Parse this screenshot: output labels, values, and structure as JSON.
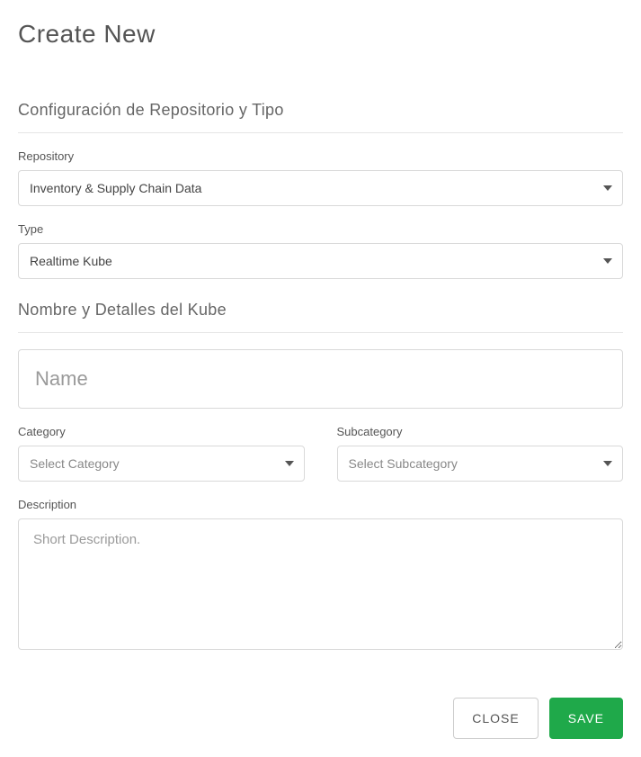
{
  "title": "Create New",
  "section1": {
    "heading": "Configuración de Repositorio y Tipo",
    "repository_label": "Repository",
    "repository_value": "Inventory & Supply Chain Data",
    "type_label": "Type",
    "type_value": "Realtime Kube"
  },
  "section2": {
    "heading": "Nombre y Detalles del Kube",
    "name_placeholder": "Name",
    "category_label": "Category",
    "category_placeholder": "Select Category",
    "subcategory_label": "Subcategory",
    "subcategory_placeholder": "Select Subcategory",
    "description_label": "Description",
    "description_placeholder": "Short Description."
  },
  "footer": {
    "close_label": "CLOSE",
    "save_label": "SAVE"
  }
}
